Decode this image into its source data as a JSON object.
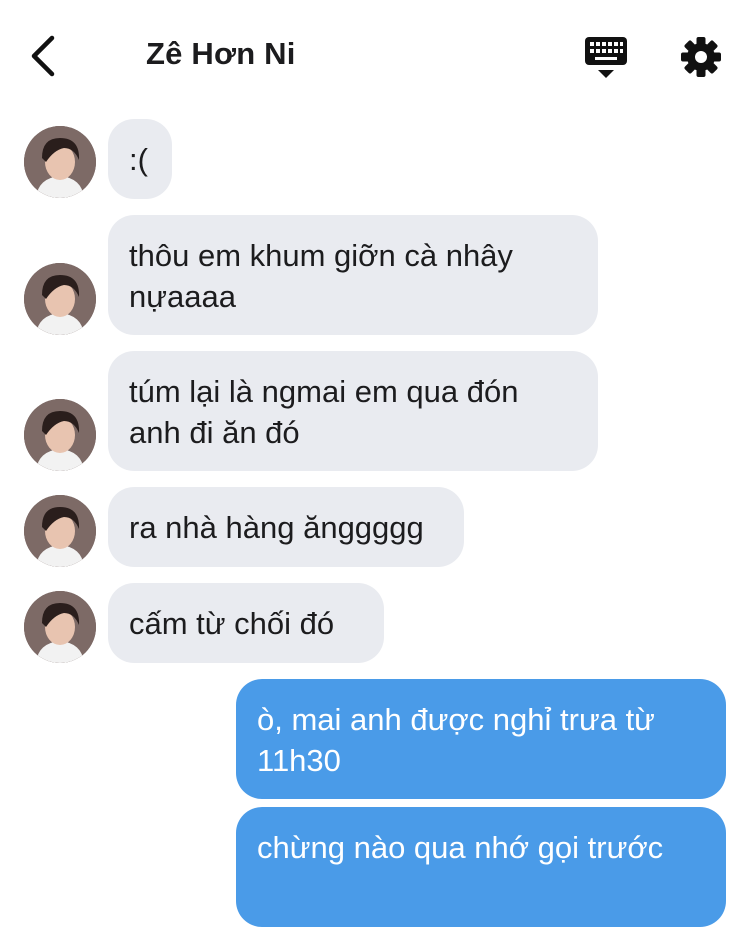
{
  "header": {
    "contact_name": "Zê Hơn Ni"
  },
  "messages": [
    {
      "direction": "incoming",
      "text": ":("
    },
    {
      "direction": "incoming",
      "text": "thôu em khum giỡn cà nhây nựaaaa"
    },
    {
      "direction": "incoming",
      "text": "túm lại là ngmai em qua đón anh đi ăn đó"
    },
    {
      "direction": "incoming",
      "text": "ra nhà hàng ănggggg"
    },
    {
      "direction": "incoming",
      "text": "cấm từ chối đó"
    },
    {
      "direction": "outgoing",
      "text": "ò, mai anh được nghỉ trưa từ 11h30"
    },
    {
      "direction": "outgoing",
      "text": "chừng nào qua nhớ gọi trước"
    }
  ],
  "colors": {
    "incoming_bubble": "#e9ebf0",
    "outgoing_bubble": "#4a9be8",
    "text_dark": "#1c1c1e",
    "text_light": "#ffffff"
  },
  "icons": {
    "back": "chevron-left-icon",
    "keyboard": "keyboard-icon",
    "settings": "gear-icon"
  }
}
